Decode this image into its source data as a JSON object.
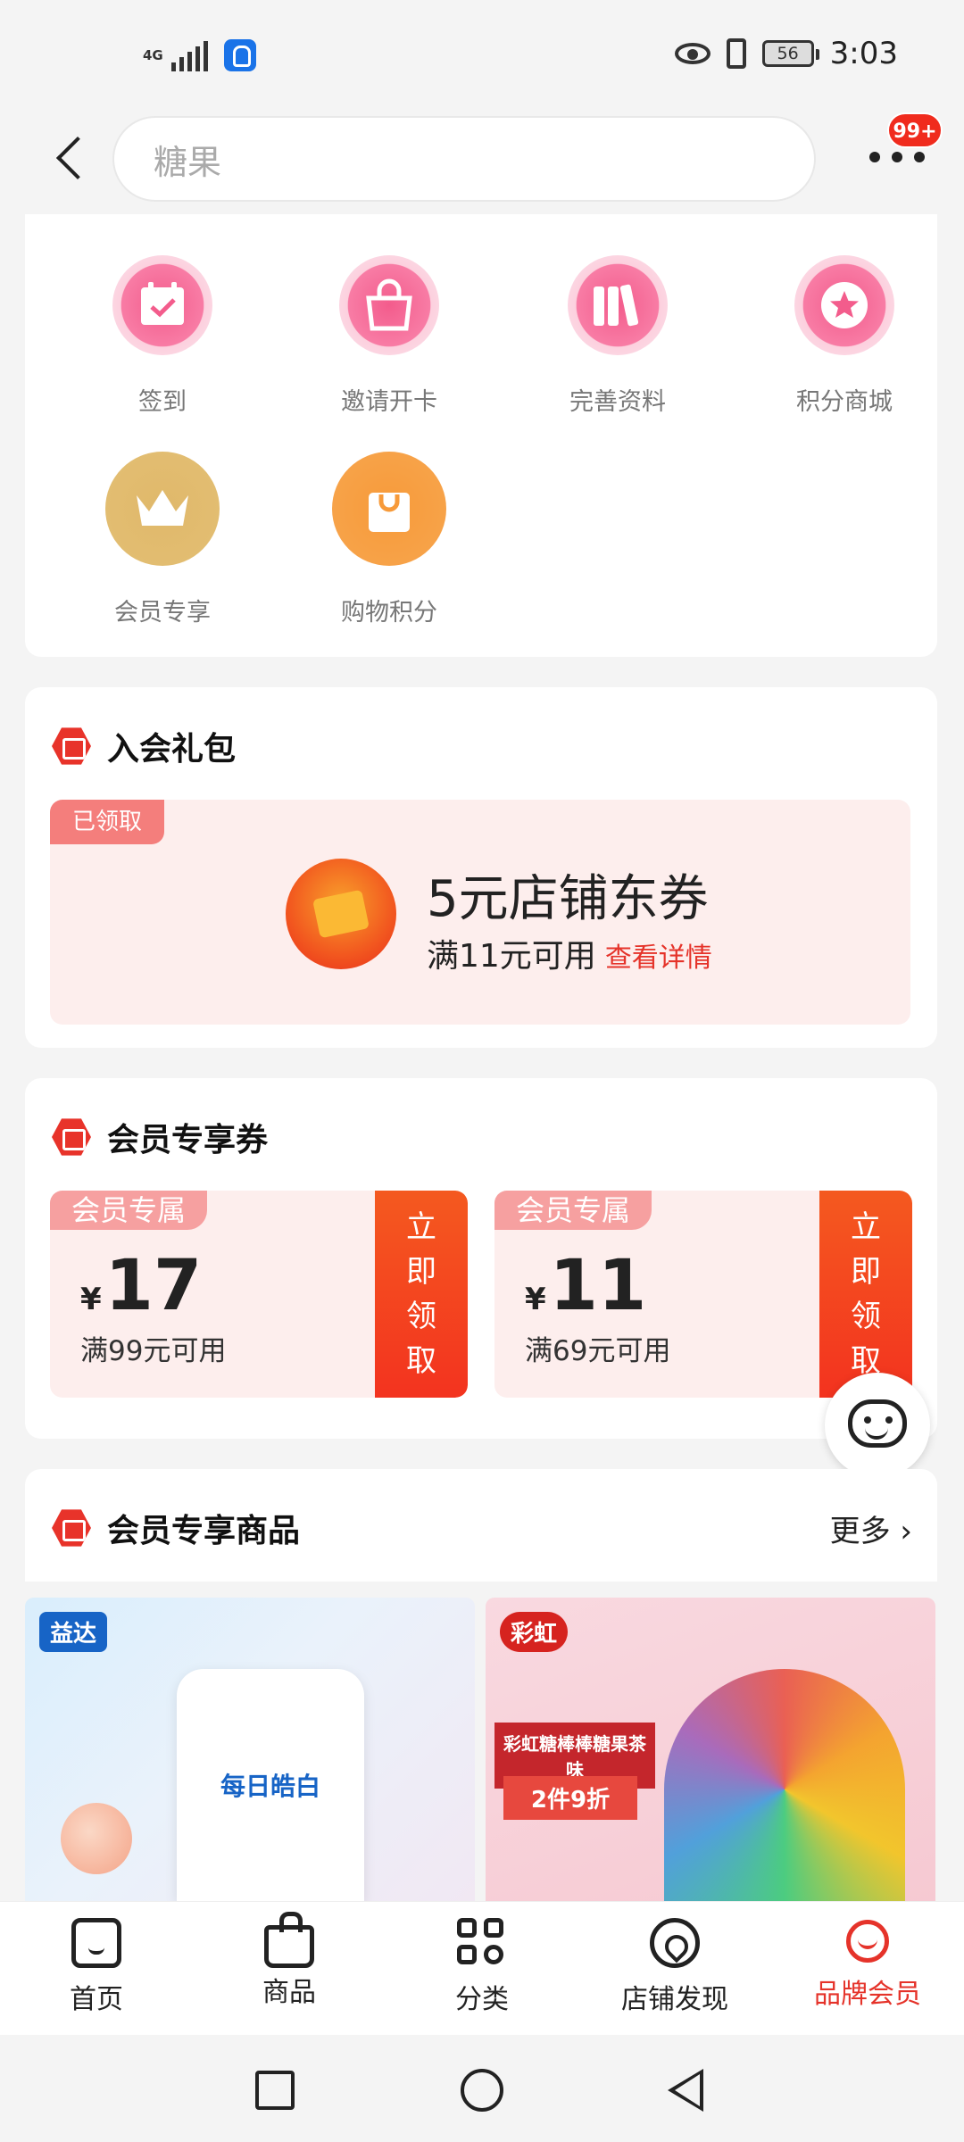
{
  "status_bar": {
    "network": "4G",
    "battery": "56",
    "time": "3:03"
  },
  "header": {
    "search_placeholder": "糖果",
    "more_badge": "99+"
  },
  "quick_actions": [
    {
      "label": "签到",
      "icon": "calendar-check-icon"
    },
    {
      "label": "邀请开卡",
      "icon": "shopping-bag-icon"
    },
    {
      "label": "完善资料",
      "icon": "books-icon"
    },
    {
      "label": "积分商城",
      "icon": "star-icon"
    },
    {
      "label": "会员专享",
      "icon": "crown-icon"
    },
    {
      "label": "购物积分",
      "icon": "shopping-bag-icon"
    }
  ],
  "gift": {
    "title": "入会礼包",
    "status": "已领取",
    "coupon_title": "5元店铺东券",
    "condition": "满11元可用",
    "detail_link": "查看详情"
  },
  "member_coupons": {
    "title": "会员专享券",
    "items": [
      {
        "tag": "会员专属",
        "currency": "¥",
        "amount": "17",
        "condition": "满99元可用",
        "button": "立即领取"
      },
      {
        "tag": "会员专属",
        "currency": "¥",
        "amount": "11",
        "condition": "满69元可用",
        "button": "立即领取"
      }
    ]
  },
  "member_products": {
    "title": "会员专享商品",
    "more": "更多 ›",
    "items": [
      {
        "brand": "益达",
        "name": "每日皓白"
      },
      {
        "brand": "彩虹",
        "banner1": "彩虹糖棒棒糖果茶味",
        "banner2": "2件9折"
      }
    ]
  },
  "tabbar": [
    {
      "label": "首页"
    },
    {
      "label": "商品"
    },
    {
      "label": "分类"
    },
    {
      "label": "店铺发现"
    },
    {
      "label": "品牌会员"
    }
  ],
  "colors": {
    "accent": "#e5332a",
    "pink": "#f87ca5",
    "gold": "#e0b86a",
    "orange": "#f79a3a"
  }
}
